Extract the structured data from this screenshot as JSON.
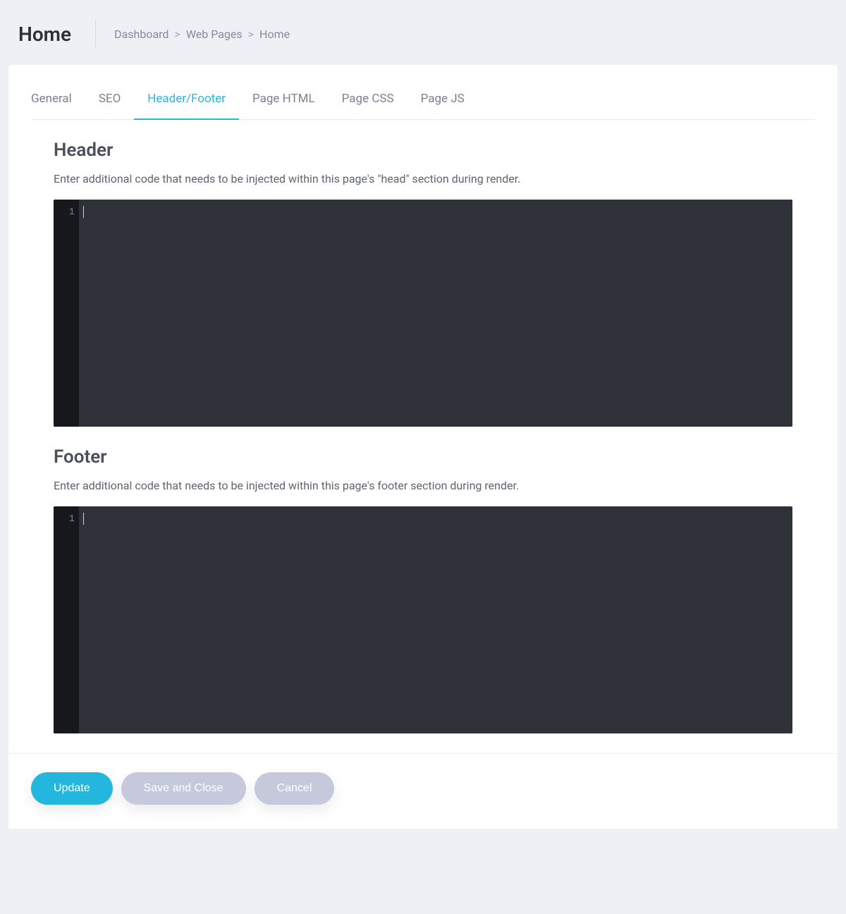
{
  "header": {
    "title": "Home"
  },
  "breadcrumb": {
    "items": [
      "Dashboard",
      "Web Pages",
      "Home"
    ],
    "separator": ">"
  },
  "tabs": [
    {
      "label": "General",
      "active": false
    },
    {
      "label": "SEO",
      "active": false
    },
    {
      "label": "Header/Footer",
      "active": true
    },
    {
      "label": "Page HTML",
      "active": false
    },
    {
      "label": "Page CSS",
      "active": false
    },
    {
      "label": "Page JS",
      "active": false
    }
  ],
  "sections": {
    "header": {
      "title": "Header",
      "desc": "Enter additional code that needs to be injected within this page's \"head\" section during render.",
      "gutter_line": "1",
      "content": ""
    },
    "footer": {
      "title": "Footer",
      "desc": "Enter additional code that needs to be injected within this page's footer section during render.",
      "gutter_line": "1",
      "content": ""
    }
  },
  "actions": {
    "update": "Update",
    "save_close": "Save and Close",
    "cancel": "Cancel"
  }
}
